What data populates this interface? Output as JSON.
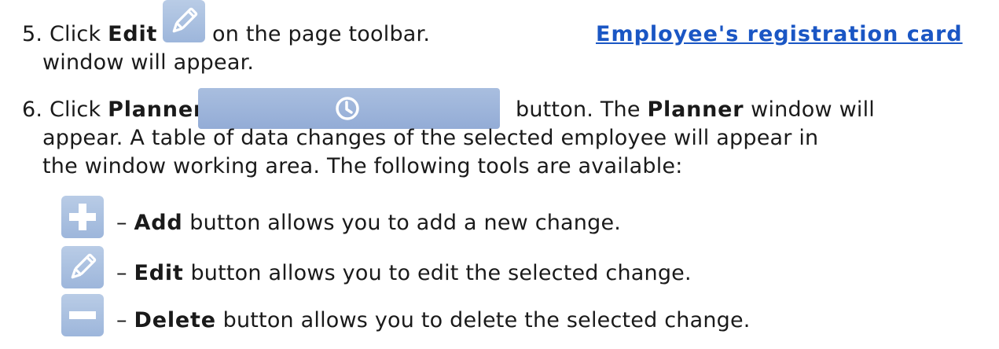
{
  "step5": {
    "number": "5.",
    "click": "Click",
    "edit_label": "Edit",
    "mid_text": "on the page toolbar.",
    "link_text": "Employee's registration card",
    "continuation": "window will appear."
  },
  "step6": {
    "number": "6.",
    "click": "Click",
    "planner_label": "Planner",
    "after_button": "button. The",
    "planner_window_label": "Planner",
    "after_window": "window will",
    "line2": "appear. A table of data changes of the selected employee will appear in",
    "line3": "the window working area. The following tools are available:"
  },
  "tools": [
    {
      "icon": "plus-icon",
      "dash": "–",
      "name": "Add",
      "desc": "button allows you to add a new change."
    },
    {
      "icon": "pencil-icon",
      "dash": "–",
      "name": "Edit",
      "desc": "button allows you to edit the selected change."
    },
    {
      "icon": "minus-icon",
      "dash": "–",
      "name": "Delete",
      "desc": "button allows you to delete the selected change."
    }
  ],
  "colors": {
    "link": "#1a56c4",
    "button_bg": "#9db6db",
    "icon_glyph": "#ffffff"
  }
}
